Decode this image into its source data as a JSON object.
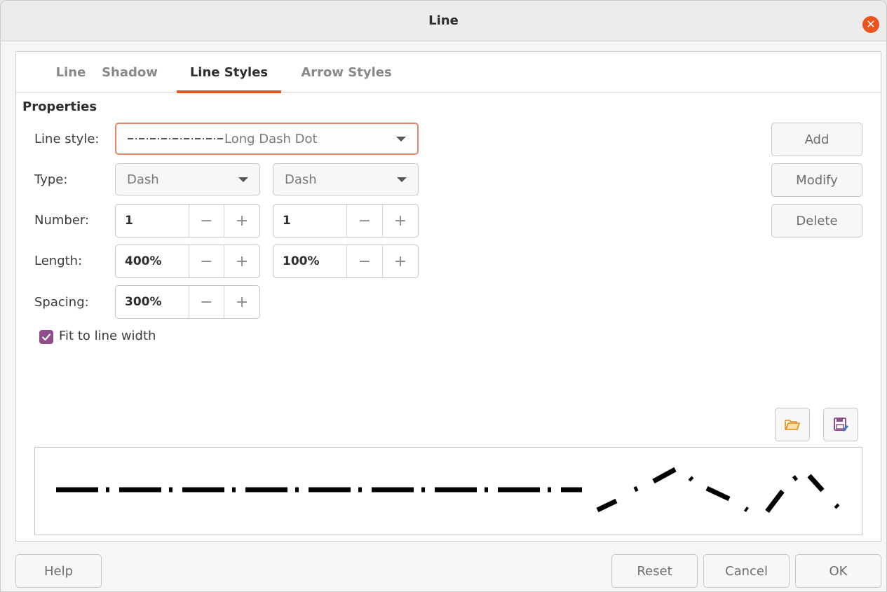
{
  "window": {
    "title": "Line"
  },
  "tabs": [
    {
      "label": "Line"
    },
    {
      "label": "Shadow"
    },
    {
      "label": "Line Styles"
    },
    {
      "label": "Arrow Styles"
    }
  ],
  "properties": {
    "section_title": "Properties",
    "line_style_label": "Line style:",
    "line_style_value": "Long Dash Dot",
    "type_label": "Type:",
    "type_1": "Dash",
    "type_2": "Dash",
    "number_label": "Number:",
    "number_1": "1",
    "number_2": "1",
    "length_label": "Length:",
    "length_1": "400%",
    "length_2": "100%",
    "spacing_label": "Spacing:",
    "spacing": "300%",
    "fit_label": "Fit to line width",
    "fit_checked": true
  },
  "side_buttons": {
    "add": "Add",
    "modify": "Modify",
    "delete": "Delete"
  },
  "icons": {
    "open": "open-folder-icon",
    "save": "save-icon"
  },
  "footer": {
    "help": "Help",
    "reset": "Reset",
    "cancel": "Cancel",
    "ok": "OK"
  },
  "colors": {
    "accent": "#e9541f",
    "checkbox": "#8f4e8b"
  }
}
